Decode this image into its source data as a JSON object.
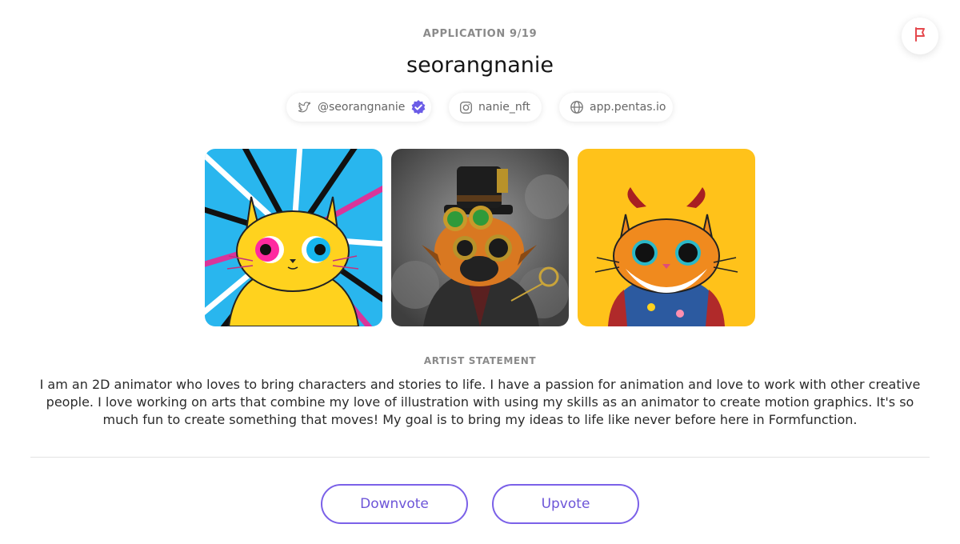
{
  "header": {
    "application_count": "APPLICATION 9/19",
    "username": "seorangnanie",
    "flag_icon": "flag-icon"
  },
  "links": [
    {
      "icon": "twitter-icon",
      "label": "@seorangnanie",
      "verified": true
    },
    {
      "icon": "instagram-icon",
      "label": "nanie_nft"
    },
    {
      "icon": "globe-icon",
      "label": "app.pentas.io"
    }
  ],
  "gallery": [
    {
      "name": "artwork-yellow-cat"
    },
    {
      "name": "artwork-steampunk-cat"
    },
    {
      "name": "artwork-devil-cat"
    }
  ],
  "statement": {
    "label": "ARTIST STATEMENT",
    "text": "I am an 2D animator who loves to bring characters and stories to life. I have a passion for animation and love to work with other creative people. I love working on arts that combine my love of illustration with using my skills as an animator to create motion graphics. It's so much fun to create something that moves! My goal is to bring my ideas to life like never before here in Formfunction."
  },
  "actions": {
    "downvote": "Downvote",
    "upvote": "Upvote"
  },
  "colors": {
    "accent": "#7b61e8",
    "flag": "#e5484d",
    "verified": "#6b5ce7"
  }
}
